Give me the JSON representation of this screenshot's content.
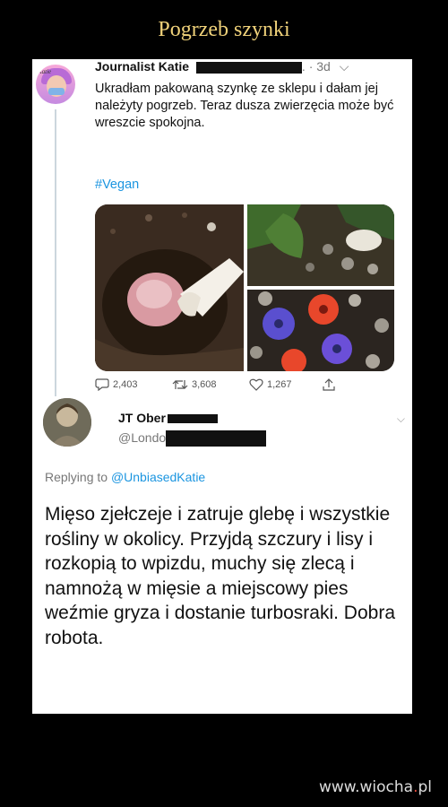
{
  "header": {
    "title": "Pogrzeb szynki"
  },
  "tweet1": {
    "author_name": "Journalist Katie",
    "time_suffix": ". · 3d",
    "avatar_tag": "Katie",
    "text": "Ukradłam pakowaną szynkę ze sklepu i dałam jej należyty pogrzeb. Teraz dusza zwierzęcia może być wreszcie spokojna.",
    "hashtag": "#Vegan",
    "stats": {
      "replies": "2,403",
      "retweets": "3,608",
      "likes": "1,267"
    }
  },
  "tweet2": {
    "author_name": "JT Ober",
    "handle": "@Londo",
    "replying_prefix": "Replying to",
    "replying_mention": "@UnbiasedKatie",
    "text": "Mięso zjełczeje i zatruje glebę i wszystkie rośliny w okolicy. Przyjdą szczury i lisy i rozkopią to wpizdu, muchy się zlecą i namnożą w mięsie a miejscowy pies weźmie gryza i dostanie turbosraki. Dobra robota."
  },
  "footer": {
    "watermark_prefix": "www.wiocha",
    "watermark_dot": ".",
    "watermark_suffix": "pl"
  },
  "colors": {
    "title": "#f0d27a",
    "link": "#1b95e0",
    "background": "#000000",
    "card": "#ffffff"
  }
}
